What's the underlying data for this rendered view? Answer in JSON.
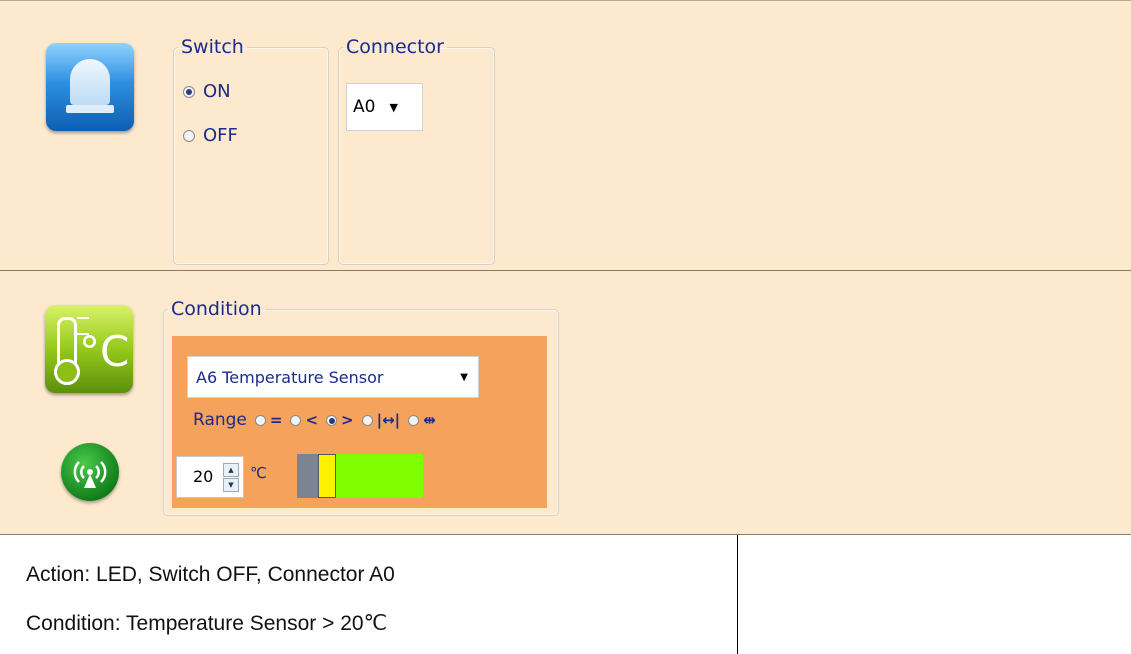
{
  "action_panel": {
    "icon": "led-icon",
    "switch_group": {
      "legend": "Switch",
      "options": [
        {
          "label": "ON",
          "checked": true
        },
        {
          "label": "OFF",
          "checked": false
        }
      ]
    },
    "connector_group": {
      "legend": "Connector",
      "selected": "A0"
    }
  },
  "condition_panel": {
    "icons": [
      "thermometer-celsius-icon",
      "wireless-signal-icon"
    ],
    "condition_group": {
      "legend": "Condition",
      "sensor": "A6 Temperature Sensor",
      "range_label": "Range",
      "range_options": [
        {
          "symbol": "=",
          "checked": false
        },
        {
          "symbol": "<",
          "checked": false
        },
        {
          "symbol": ">",
          "checked": true
        },
        {
          "symbol": "|↔|",
          "checked": false
        },
        {
          "symbol": "⇹",
          "checked": false
        }
      ],
      "value": "20",
      "unit": "℃",
      "range_bar": {
        "threshold_fraction": 0.18,
        "below_color": "#7c858f",
        "above_color": "#7fff00",
        "thumb_color": "#fff200"
      }
    }
  },
  "summary": {
    "action": "Action: LED, Switch OFF, Connector A0",
    "condition": "Condition: Temperature Sensor > 20℃"
  },
  "colors": {
    "panel_bg": "#fde9cd",
    "condition_bg": "#f4a25c",
    "label_text": "#1c2a8c"
  }
}
